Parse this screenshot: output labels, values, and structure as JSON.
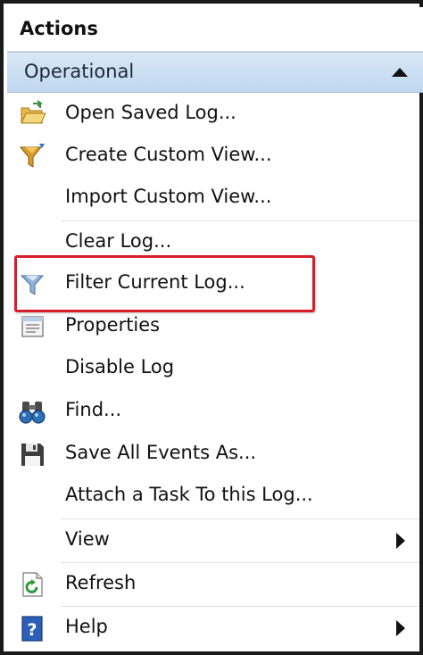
{
  "pane": {
    "title": "Actions"
  },
  "section": {
    "title": "Operational"
  },
  "items": [
    {
      "label": "Open Saved Log...",
      "icon": "folder-open-icon"
    },
    {
      "label": "Create Custom View...",
      "icon": "filter-create-icon"
    },
    {
      "label": "Import Custom View...",
      "icon": ""
    },
    {
      "label": "Clear Log...",
      "icon": ""
    },
    {
      "label": "Filter Current Log...",
      "icon": "filter-icon"
    },
    {
      "label": "Properties",
      "icon": "properties-icon"
    },
    {
      "label": "Disable Log",
      "icon": ""
    },
    {
      "label": "Find...",
      "icon": "binoculars-icon"
    },
    {
      "label": "Save All Events As...",
      "icon": "floppy-disk-icon"
    },
    {
      "label": "Attach a Task To this Log...",
      "icon": ""
    },
    {
      "label": "View",
      "icon": ""
    },
    {
      "label": "Refresh",
      "icon": "refresh-icon"
    },
    {
      "label": "Help",
      "icon": "help-icon"
    }
  ],
  "colors": {
    "highlight": "#d71e2b",
    "section_header": "#c9dcf1",
    "text": "#111111"
  }
}
